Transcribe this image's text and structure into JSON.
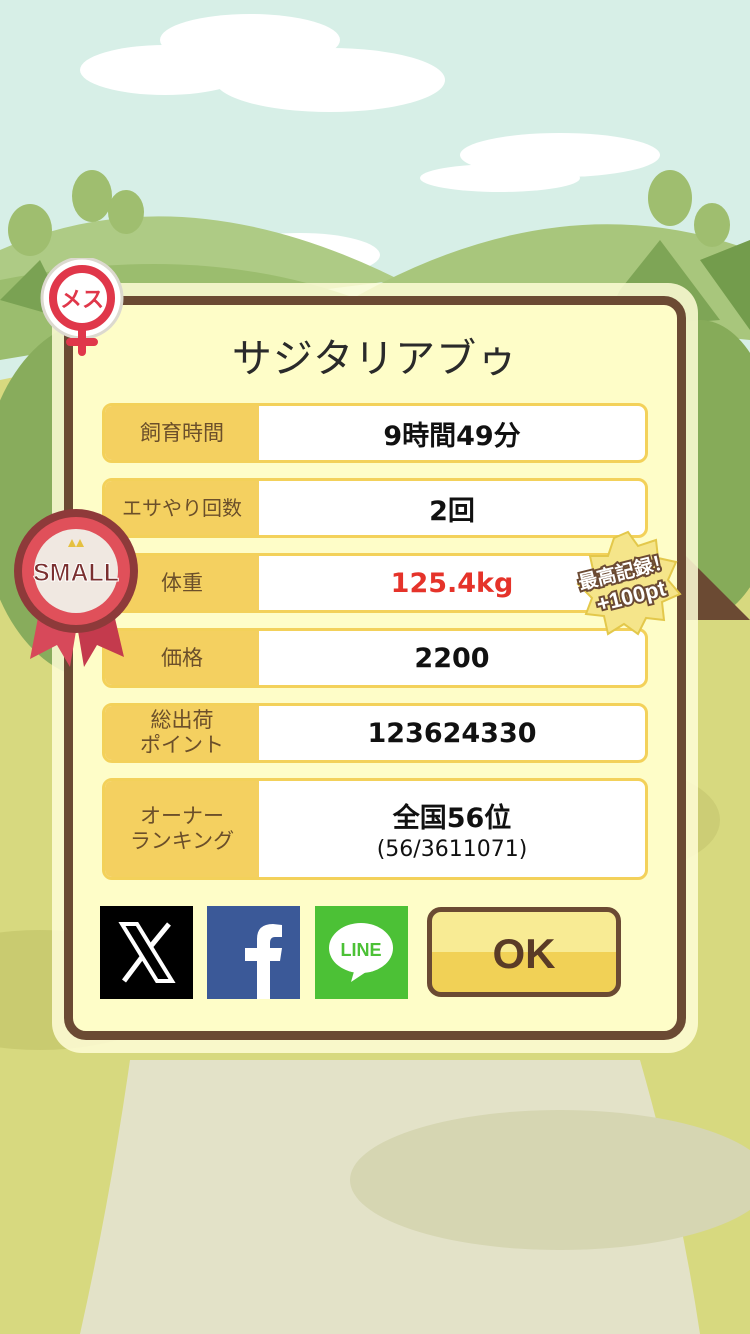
{
  "pig": {
    "name": "サジタリアブゥ",
    "gender_label": "メス",
    "size_label": "SMALL"
  },
  "stats": [
    {
      "label": "飼育時間",
      "value": "9時間49分"
    },
    {
      "label": "エサやり回数",
      "value": "2回"
    },
    {
      "label": "体重",
      "value": "125.4kg"
    },
    {
      "label": "価格",
      "value": "2200"
    },
    {
      "label": "総出荷\nポイント",
      "value": "123624330"
    },
    {
      "label": "オーナー\nランキング",
      "value": "全国56位",
      "sub": "(56/3611071)"
    }
  ],
  "record_badge": {
    "line1": "最高記録！",
    "line2": "+100pt"
  },
  "share": {
    "x_label": "X",
    "facebook_label": "f",
    "line_label": "LINE"
  },
  "ok_label": "OK",
  "colors": {
    "panel": "#fefdc8",
    "frame": "#6b4a33",
    "label_bg": "#f4d060",
    "weight_value": "#e5332a"
  }
}
